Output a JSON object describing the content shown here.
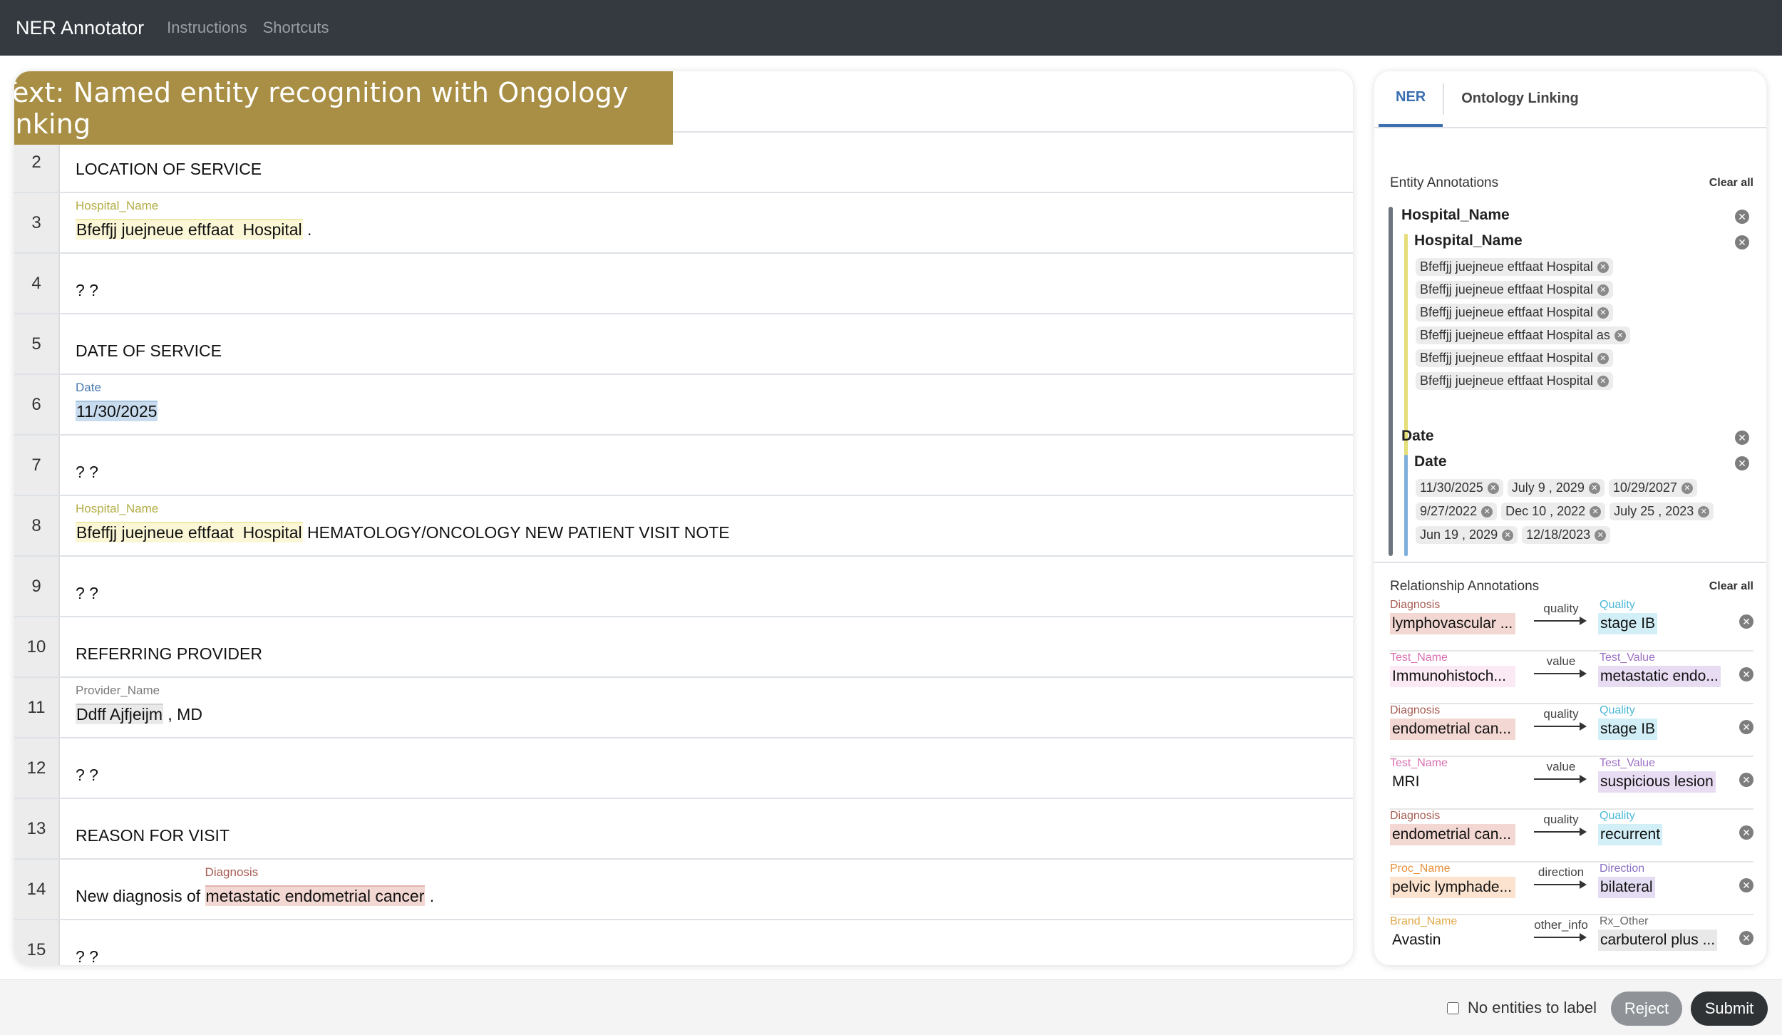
{
  "nav": {
    "brand": "NER Annotator",
    "links": [
      "Instructions",
      "Shortcuts"
    ]
  },
  "banner": "Text: Named entity recognition with Ongology linking",
  "lines": [
    {
      "num": "2",
      "segments": [
        {
          "text": "LOCATION OF SERVICE"
        }
      ]
    },
    {
      "num": "3",
      "segments": [
        {
          "text": "Bfeffjj juejneue eftfaat  Hospital",
          "entity": "Hospital_Name"
        },
        {
          "text": " ."
        }
      ]
    },
    {
      "num": "4",
      "segments": [
        {
          "text": "? ?"
        }
      ]
    },
    {
      "num": "5",
      "segments": [
        {
          "text": "DATE OF SERVICE"
        }
      ]
    },
    {
      "num": "6",
      "segments": [
        {
          "text": "11/30/2025",
          "entity": "Date"
        }
      ]
    },
    {
      "num": "7",
      "segments": [
        {
          "text": "? ?"
        }
      ]
    },
    {
      "num": "8",
      "segments": [
        {
          "text": "Bfeffjj juejneue eftfaat  Hospital",
          "entity": "Hospital_Name"
        },
        {
          "text": " HEMATOLOGY/ONCOLOGY NEW PATIENT VISIT NOTE"
        }
      ]
    },
    {
      "num": "9",
      "segments": [
        {
          "text": "? ?"
        }
      ]
    },
    {
      "num": "10",
      "segments": [
        {
          "text": "REFERRING PROVIDER"
        }
      ]
    },
    {
      "num": "11",
      "segments": [
        {
          "text": "Ddff Ajfjeijm",
          "entity": "Provider_Name"
        },
        {
          "text": " , MD"
        }
      ]
    },
    {
      "num": "12",
      "segments": [
        {
          "text": "? ?"
        }
      ]
    },
    {
      "num": "13",
      "segments": [
        {
          "text": "REASON FOR VISIT"
        }
      ]
    },
    {
      "num": "14",
      "segments": [
        {
          "text": "New diagnosis of "
        },
        {
          "text": "metastatic endometrial cancer",
          "entity": "Diagnosis"
        },
        {
          "text": " ."
        }
      ]
    },
    {
      "num": "15",
      "segments": [
        {
          "text": "? ?"
        }
      ]
    }
  ],
  "side": {
    "tabs": [
      "NER",
      "Ontology Linking"
    ],
    "entity_section": {
      "title": "Entity Annotations",
      "clear": "Clear all"
    },
    "groups": [
      {
        "title": "Hospital_Name",
        "sub_title": "Hospital_Name",
        "color": "#e4df7a",
        "chips": [
          "Bfeffjj juejneue eftfaat Hospital",
          "Bfeffjj juejneue eftfaat Hospital",
          "Bfeffjj juejneue eftfaat Hospital",
          "Bfeffjj juejneue eftfaat Hospital as",
          "Bfeffjj juejneue eftfaat Hospital",
          "Bfeffjj juejneue eftfaat Hospital"
        ]
      },
      {
        "title": "Date",
        "sub_title": "Date",
        "color": "#7fb0db",
        "chips": [
          "11/30/2025",
          "July 9 , 2029",
          "10/29/2027",
          "9/27/2022",
          "Dec 10 , 2022",
          "July 25 , 2023",
          "Jun 19 , 2029",
          "12/18/2023"
        ]
      }
    ],
    "relationship_section": {
      "title": "Relationship Annotations",
      "clear": "Clear all"
    },
    "relations": [
      {
        "src_label": "Diagnosis",
        "src_color": "#a65c52",
        "src_bg": "#f2d7d2",
        "src": "lymphovascular ...",
        "type": "quality",
        "tgt_label": "Quality",
        "tgt_color": "#4cb8d6",
        "tgt_bg": "#d2eff7",
        "tgt": "stage IB"
      },
      {
        "src_label": "Test_Name",
        "src_color": "#d86fb0",
        "src_bg": "#fbeaf4",
        "src": "Immunohistoch...",
        "type": "value",
        "tgt_label": "Test_Value",
        "tgt_color": "#9c6fc2",
        "tgt_bg": "#e8dcf3",
        "tgt": "metastatic endo..."
      },
      {
        "src_label": "Diagnosis",
        "src_color": "#a65c52",
        "src_bg": "#f2d7d2",
        "src": "endometrial can...",
        "type": "quality",
        "tgt_label": "Quality",
        "tgt_color": "#4cb8d6",
        "tgt_bg": "#d2eff7",
        "tgt": "stage IB"
      },
      {
        "src_label": "Test_Name",
        "src_color": "#d86fb0",
        "src_bg": "#ffffff",
        "src": "MRI",
        "type": "value",
        "tgt_label": "Test_Value",
        "tgt_color": "#9c6fc2",
        "tgt_bg": "#e8dcf3",
        "tgt": "suspicious lesion"
      },
      {
        "src_label": "Diagnosis",
        "src_color": "#a65c52",
        "src_bg": "#f2d7d2",
        "src": "endometrial can...",
        "type": "quality",
        "tgt_label": "Quality",
        "tgt_color": "#4cb8d6",
        "tgt_bg": "#d2eff7",
        "tgt": "recurrent"
      },
      {
        "src_label": "Proc_Name",
        "src_color": "#e8903a",
        "src_bg": "#fbe3cf",
        "src": "pelvic lymphade...",
        "type": "direction",
        "tgt_label": "Direction",
        "tgt_color": "#8a6fc2",
        "tgt_bg": "#e3dcf3",
        "tgt": "bilateral"
      },
      {
        "src_label": "Brand_Name",
        "src_color": "#e0a94a",
        "src_bg": "#ffffff",
        "src": "Avastin",
        "type": "other_info",
        "tgt_label": "Rx_Other",
        "tgt_color": "#666666",
        "tgt_bg": "#e8e8e8",
        "tgt": "carbuterol plus ..."
      }
    ]
  },
  "footer": {
    "no_entities": "No entities to label",
    "reject": "Reject",
    "submit": "Submit"
  }
}
